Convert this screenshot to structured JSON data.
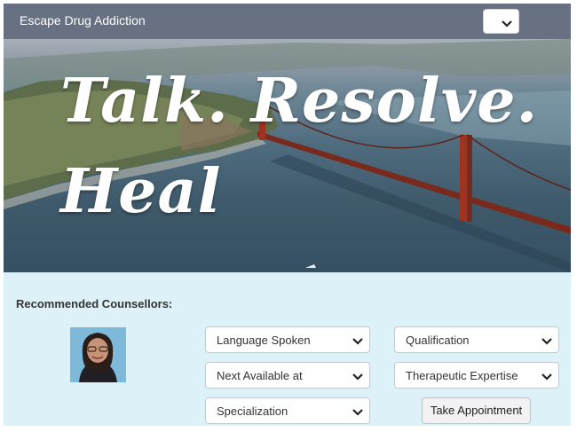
{
  "header": {
    "title": "Escape Drug Addiction",
    "nav_select_value": "",
    "background": "#687181"
  },
  "hero": {
    "line1": "Talk. Resolve.",
    "line2": "Heal",
    "image": "golden-gate-bridge-aerial"
  },
  "panel": {
    "background": "#dcf2f8",
    "section_title": "Recommended Counsellors:",
    "counsellor_photo": "counsellor-avatar",
    "filters": {
      "language": "Language Spoken",
      "qualification": "Qualification",
      "next_available": "Next Available at",
      "expertise": "Therapeutic Expertise",
      "specialization": "Specialization"
    },
    "appointment_button": "Take Appointment"
  }
}
